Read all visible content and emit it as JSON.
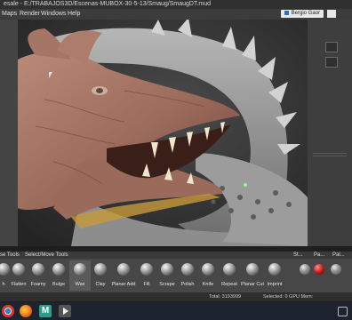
{
  "titlebar": {
    "text": "esale - E:/TRABAJOS3D/Escenas-MUBOX-30-5-13/Smaug/SmaugDT.mud"
  },
  "menu": {
    "items": [
      "Maps",
      "Render",
      "Windows",
      "Help"
    ]
  },
  "user": {
    "name": "Bergio Gaor"
  },
  "shelf": {
    "tabs": [
      "se Tools",
      "Select/Move Tools",
      "St...",
      "Pa...",
      "Pal..."
    ],
    "tools": [
      "h",
      "Flatten",
      "Foamy",
      "Bulge",
      "Wax",
      "Clay",
      "Planar Add",
      "Fill",
      "Scrape",
      "Polish",
      "Knife",
      "Repeat",
      "Planar Cut",
      "Imprint"
    ]
  },
  "status": {
    "left": "Total: 3193999",
    "right": "Selected: 0 GPU Mem:"
  },
  "colors": {
    "titlebar": "#303030",
    "menubar": "#3c3c3c",
    "viewport": "#333333",
    "shelf": "#474747",
    "taskbar": "#1d2430",
    "accent": "#2a72c0"
  },
  "taskbar": {
    "icons": [
      "chrome-icon",
      "firefox-icon",
      "mudbox-icon",
      "media-icon"
    ]
  }
}
